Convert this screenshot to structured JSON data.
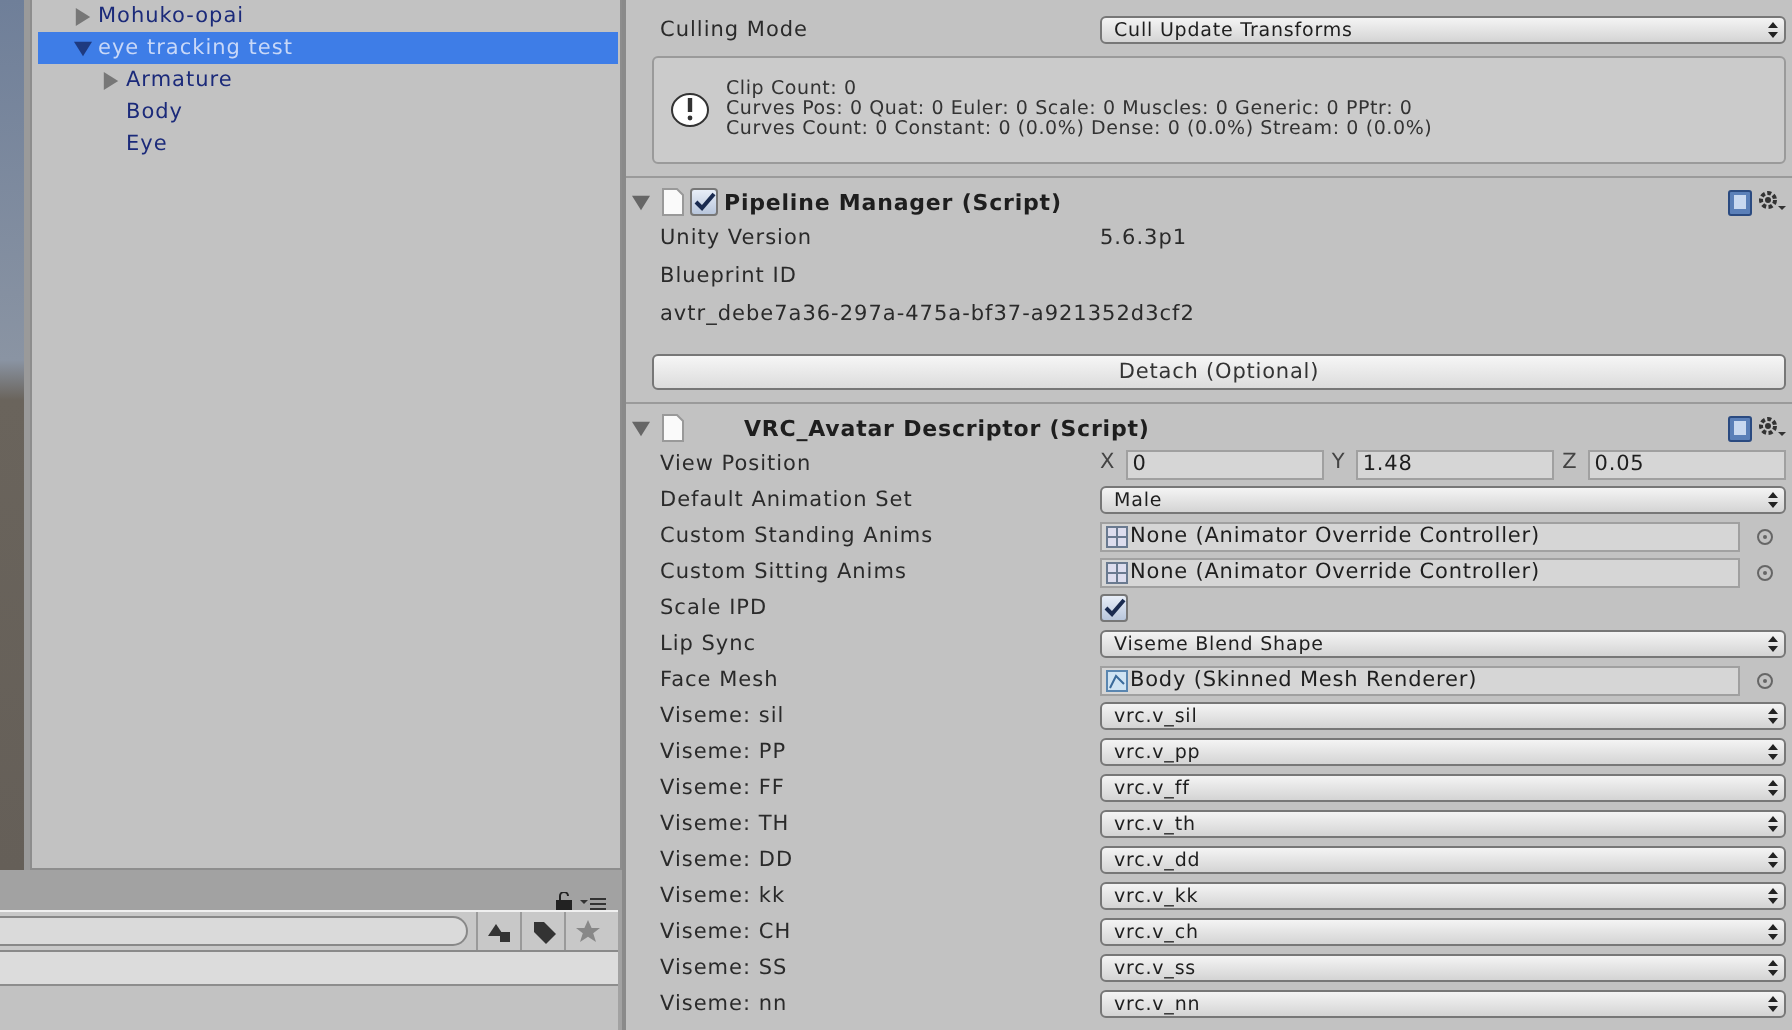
{
  "hierarchy": {
    "items": [
      {
        "label": "Mohuko-opai",
        "expanded": false,
        "selected": false
      },
      {
        "label": "eye tracking test",
        "expanded": true,
        "selected": true,
        "children": [
          {
            "label": "Armature",
            "expanded": false,
            "selected": false
          },
          {
            "label": "Body",
            "selected": false
          },
          {
            "label": "Eye",
            "selected": false
          }
        ]
      }
    ]
  },
  "inspector": {
    "top_fields": [
      {
        "kind": "dropdown",
        "label": "Culling Mode",
        "value": "Cull Update Transforms"
      }
    ],
    "info_box": {
      "lines": [
        "Clip Count: 0",
        "Curves Pos: 0 Quat: 0 Euler: 0 Scale: 0 Muscles: 0 Generic: 0 PPtr: 0",
        "Curves Count: 0 Constant: 0 (0.0%) Dense: 0 (0.0%) Stream: 0 (0.0%)"
      ]
    },
    "components": [
      {
        "title": "Pipeline Manager (Script)",
        "expanded": true,
        "enabled": true,
        "fields": [
          {
            "kind": "text",
            "label": "Unity Version",
            "value": "5.6.3p1"
          },
          {
            "kind": "label",
            "label": "Blueprint ID"
          },
          {
            "kind": "label",
            "label": "avtr_debe7a36-297a-475a-bf37-a921352d3cf2"
          }
        ],
        "button": "Detach (Optional)"
      },
      {
        "title": "VRC_Avatar Descriptor (Script)",
        "expanded": true,
        "fields": [
          {
            "kind": "vector3",
            "label": "View Position",
            "axes": [
              {
                "axis": "X",
                "value": "0"
              },
              {
                "axis": "Y",
                "value": "1.48"
              },
              {
                "axis": "Z",
                "value": "0.05"
              }
            ]
          },
          {
            "kind": "dropdown",
            "label": "Default Animation Set",
            "value": "Male"
          },
          {
            "kind": "animobject",
            "label": "Custom Standing Anims",
            "value": "None (Animator Override Controller)"
          },
          {
            "kind": "animobject",
            "label": "Custom Sitting Anims",
            "value": "None (Animator Override Controller)"
          },
          {
            "kind": "checkbox",
            "label": "Scale IPD",
            "checked": true
          },
          {
            "kind": "dropdown",
            "label": "Lip Sync",
            "value": "Viseme Blend Shape"
          },
          {
            "kind": "meshobject",
            "label": "Face Mesh",
            "value": "Body (Skinned Mesh Renderer)"
          },
          {
            "kind": "dropdown",
            "label": "Viseme: sil",
            "value": "vrc.v_sil"
          },
          {
            "kind": "dropdown",
            "label": "Viseme: PP",
            "value": "vrc.v_pp"
          },
          {
            "kind": "dropdown",
            "label": "Viseme: FF",
            "value": "vrc.v_ff"
          },
          {
            "kind": "dropdown",
            "label": "Viseme: TH",
            "value": "vrc.v_th"
          },
          {
            "kind": "dropdown",
            "label": "Viseme: DD",
            "value": "vrc.v_dd"
          },
          {
            "kind": "dropdown",
            "label": "Viseme: kk",
            "value": "vrc.v_kk"
          },
          {
            "kind": "dropdown",
            "label": "Viseme: CH",
            "value": "vrc.v_ch"
          },
          {
            "kind": "dropdown",
            "label": "Viseme: SS",
            "value": "vrc.v_ss"
          },
          {
            "kind": "dropdown",
            "label": "Viseme: nn",
            "value": "vrc.v_nn"
          }
        ]
      }
    ]
  }
}
